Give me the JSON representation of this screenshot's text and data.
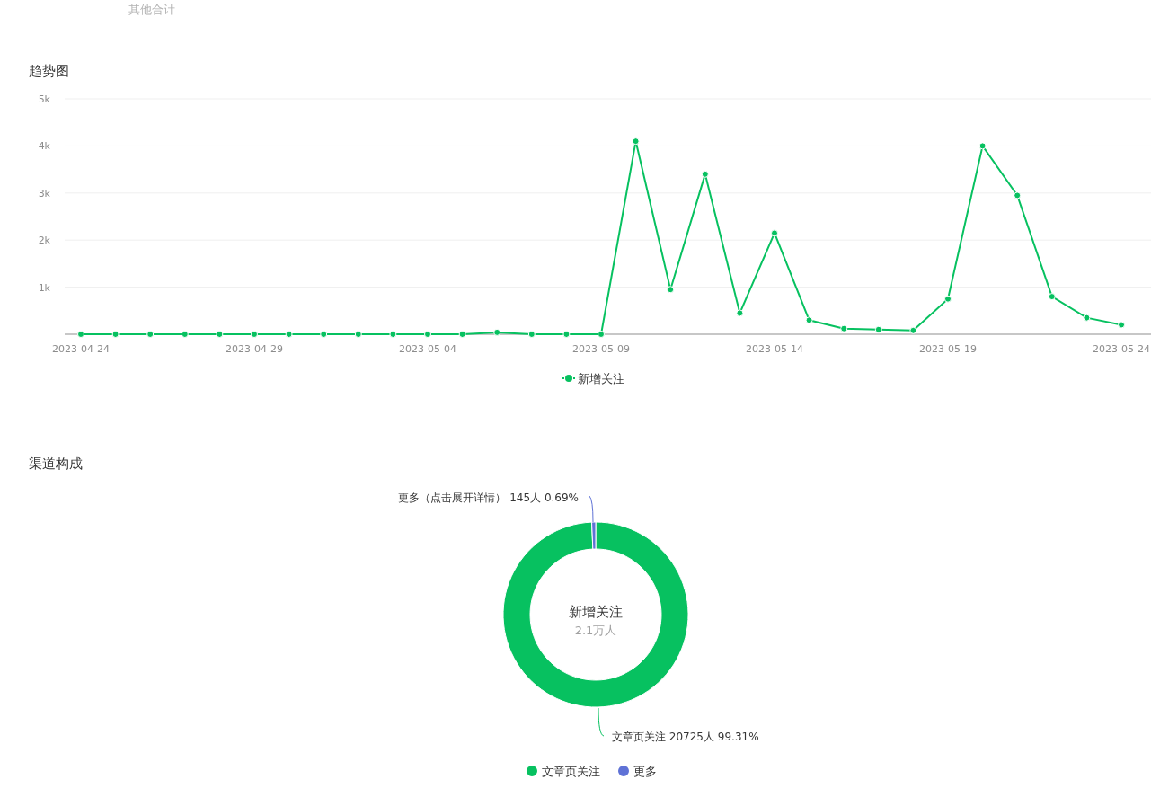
{
  "header": {
    "label": "其他合计"
  },
  "trend": {
    "title": "趋势图",
    "chart_data": {
      "type": "line",
      "legend": "bottom",
      "grid": true,
      "categories": [
        "2023-04-24",
        null,
        null,
        null,
        null,
        "2023-04-29",
        null,
        null,
        null,
        null,
        "2023-05-04",
        null,
        null,
        null,
        null,
        "2023-05-09",
        null,
        null,
        null,
        null,
        "2023-05-14",
        null,
        null,
        null,
        null,
        "2023-05-19",
        null,
        null,
        null,
        null,
        "2023-05-24"
      ],
      "series": [
        {
          "name": "新增关注",
          "color": "#07c160",
          "marker": "circle",
          "values": [
            0,
            0,
            0,
            0,
            0,
            0,
            0,
            0,
            0,
            0,
            0,
            0,
            40,
            0,
            0,
            0,
            4100,
            950,
            3400,
            450,
            2150,
            300,
            120,
            100,
            80,
            750,
            4000,
            2950,
            800,
            350,
            200
          ]
        }
      ],
      "ylim": [
        0,
        5000
      ],
      "yticks": [
        {
          "value": 1000,
          "label": "1k"
        },
        {
          "value": 2000,
          "label": "2k"
        },
        {
          "value": 3000,
          "label": "3k"
        },
        {
          "value": 4000,
          "label": "4k"
        },
        {
          "value": 5000,
          "label": "5k"
        }
      ]
    }
  },
  "channels": {
    "title": "渠道构成",
    "center_title": "新增关注",
    "center_value": "2.1万人",
    "slice_labels": [
      {
        "text": "文章页关注 20725人 99.31%"
      },
      {
        "text": "更多（点击展开详情） 145人 0.69%"
      }
    ],
    "chart_data": {
      "type": "donut",
      "legend": "bottom",
      "categories": [
        "文章页关注",
        "更多"
      ],
      "values": [
        99.31,
        0.69
      ],
      "colors": [
        "#07c160",
        "#5f72d6"
      ]
    }
  }
}
